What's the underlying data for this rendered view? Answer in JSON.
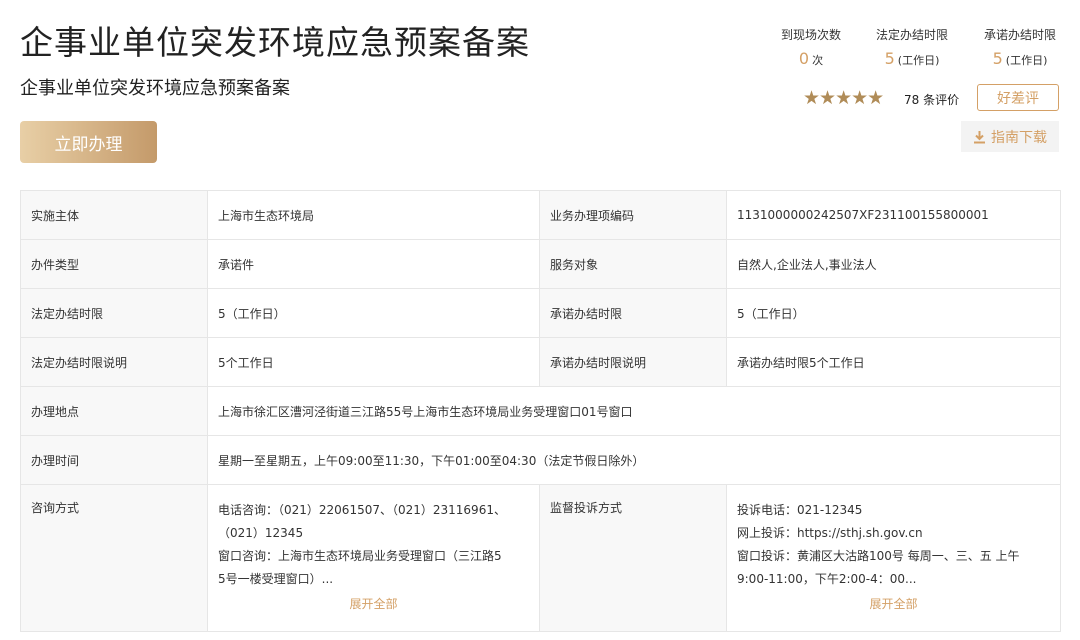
{
  "header": {
    "title": "企事业单位突发环境应急预案备案",
    "subtitle": "企事业单位突发环境应急预案备案",
    "apply_label": "立即办理"
  },
  "stats": [
    {
      "label": "到现场次数",
      "value": "0",
      "unit": "次"
    },
    {
      "label": "法定办结时限",
      "value": "5",
      "unit": "(工作日)"
    },
    {
      "label": "承诺办结时限",
      "value": "5",
      "unit": "(工作日)"
    }
  ],
  "rating": {
    "stars": "★★★★★",
    "count_text": "78 条评价",
    "review_label": "好差评"
  },
  "guide_download_label": "指南下载",
  "info": {
    "r1": {
      "l1": "实施主体",
      "v1": "上海市生态环境局",
      "l2": "业务办理项编码",
      "v2": "1131000000242507XF231100155800001"
    },
    "r2": {
      "l1": "办件类型",
      "v1": "承诺件",
      "l2": "服务对象",
      "v2": "自然人,企业法人,事业法人"
    },
    "r3": {
      "l1": "法定办结时限",
      "v1": "5（工作日）",
      "l2": "承诺办结时限",
      "v2": "5（工作日）"
    },
    "r4": {
      "l1": "法定办结时限说明",
      "v1": "5个工作日",
      "l2": "承诺办结时限说明",
      "v2": "承诺办结时限5个工作日"
    },
    "r5": {
      "l1": "办理地点",
      "v1": "上海市徐汇区漕河泾街道三江路55号上海市生态环境局业务受理窗口01号窗口"
    },
    "r6": {
      "l1": "办理时间",
      "v1": "星期一至星期五，上午09:00至11:30，下午01:00至04:30（法定节假日除外）"
    },
    "r7": {
      "l1": "咨询方式",
      "consult_lines": [
        "电话咨询：（021）22061507、（021）23116961、",
        "（021）12345",
        "窗口咨询：上海市生态环境局业务受理窗口（三江路5",
        "5号一楼受理窗口）..."
      ],
      "l2": "监督投诉方式",
      "complaint_lines": [
        "投诉电话：021-12345",
        "网上投诉：https://sthj.sh.gov.cn",
        "窗口投诉：黄浦区大沽路100号 每周一、三、五 上午",
        "9:00-11:00，下午2:00-4：00..."
      ],
      "expand_label": "展开全部"
    }
  }
}
